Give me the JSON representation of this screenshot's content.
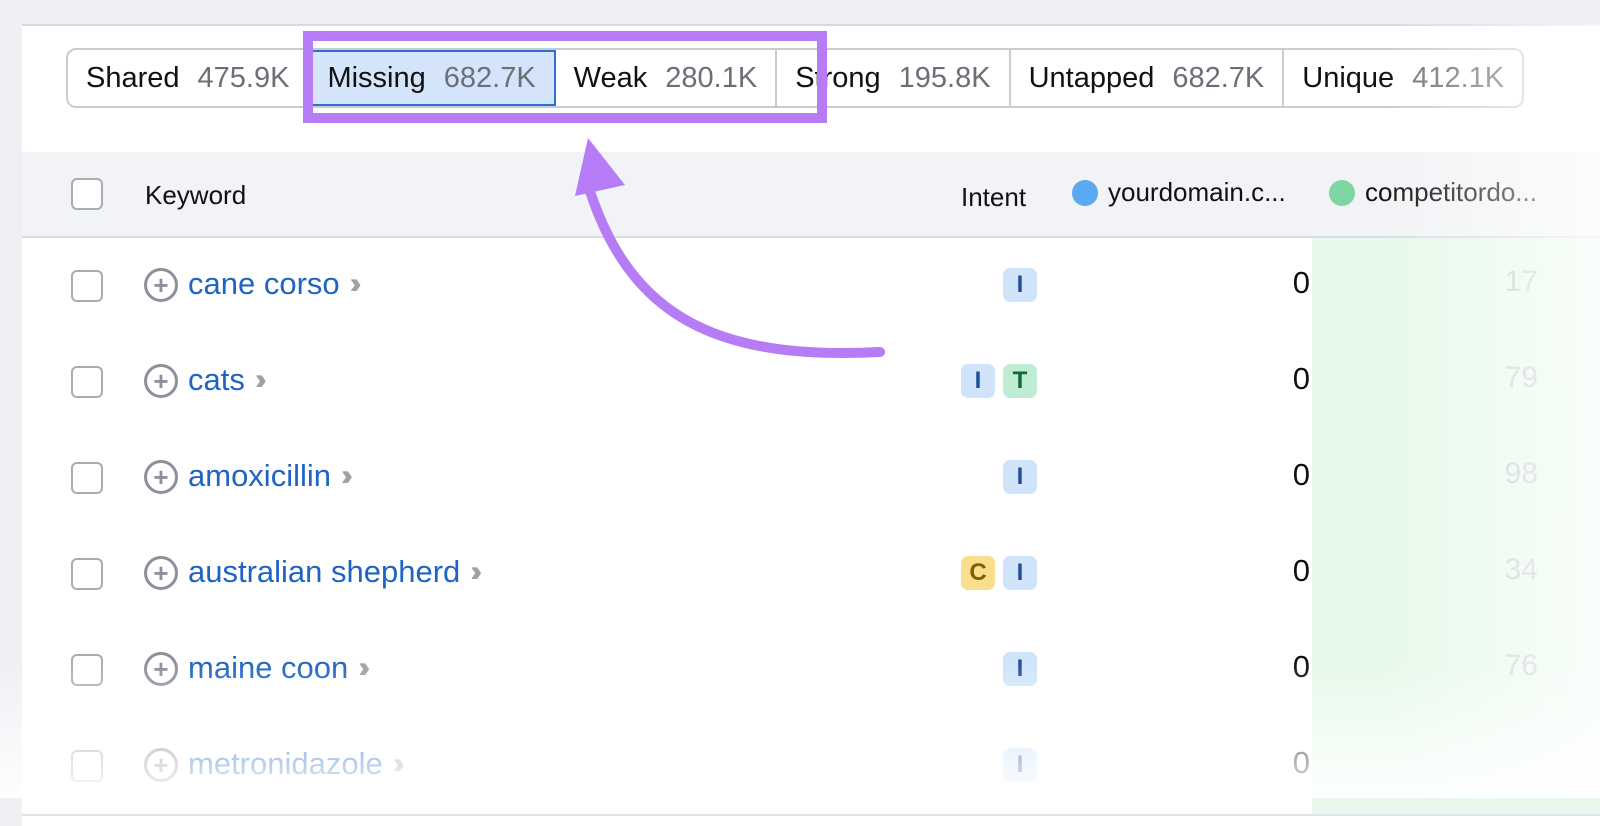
{
  "tabs": [
    {
      "label": "Shared",
      "count": "475.9K"
    },
    {
      "label": "Missing",
      "count": "682.7K"
    },
    {
      "label": "Weak",
      "count": "280.1K"
    },
    {
      "label": "Strong",
      "count": "195.8K"
    },
    {
      "label": "Untapped",
      "count": "682.7K"
    },
    {
      "label": "Unique",
      "count": "412.1K"
    }
  ],
  "table": {
    "headers": {
      "keyword": "Keyword",
      "intent": "Intent",
      "domain1": "yourdomain.c...",
      "domain2": "competitordo..."
    },
    "rows": [
      {
        "keyword": "cane corso",
        "intents": [
          "I"
        ],
        "yours": "0",
        "competitor": "17"
      },
      {
        "keyword": "cats",
        "intents": [
          "I",
          "T"
        ],
        "yours": "0",
        "competitor": "79"
      },
      {
        "keyword": "amoxicillin",
        "intents": [
          "I"
        ],
        "yours": "0",
        "competitor": "98"
      },
      {
        "keyword": "australian shepherd",
        "intents": [
          "C",
          "I"
        ],
        "yours": "0",
        "competitor": "34"
      },
      {
        "keyword": "maine coon",
        "intents": [
          "I"
        ],
        "yours": "0",
        "competitor": "76"
      },
      {
        "keyword": "metronidazole",
        "intents": [
          "I"
        ],
        "yours": "0",
        "competitor": ""
      }
    ]
  },
  "colors": {
    "domain1_dot": "#5aaaf3",
    "domain2_dot": "#7fd6a0",
    "annotation": "#b57cf6",
    "link": "#1f64c4"
  },
  "icons": {
    "add": "plus-circle-icon",
    "more": "double-chevron-right-icon",
    "annotation": "curved-arrow-icon"
  }
}
